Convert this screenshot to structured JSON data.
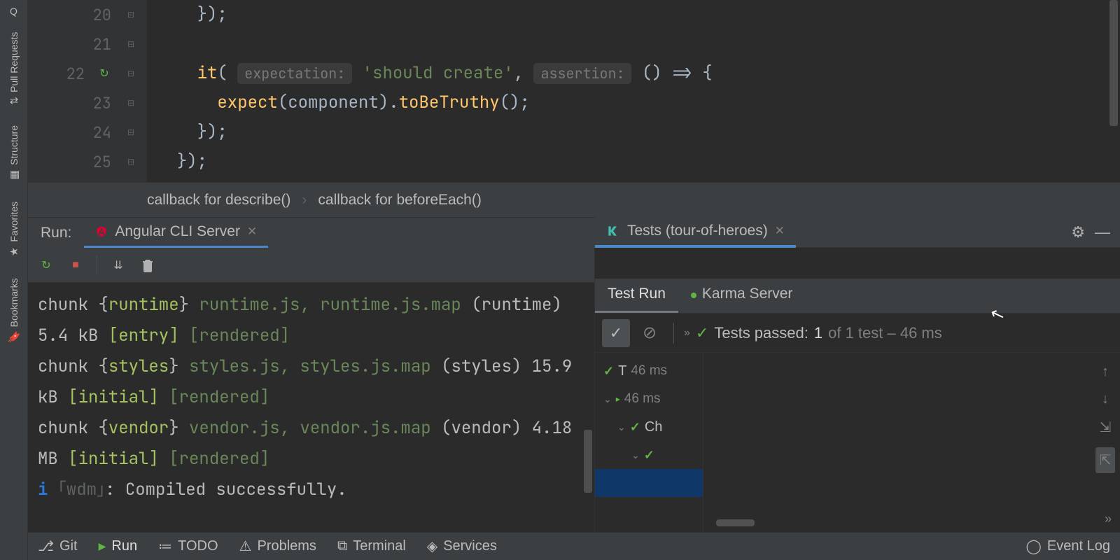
{
  "left_rail": {
    "items": [
      "Q",
      "Pull Requests",
      "Structure",
      "Favorites",
      "Bookmarks"
    ]
  },
  "editor": {
    "lines": [
      {
        "num": "20",
        "indent": "    ",
        "tokens": [
          {
            "t": "});",
            "cls": "kw-gray"
          }
        ]
      },
      {
        "num": "21",
        "indent": "",
        "tokens": []
      },
      {
        "num": "22",
        "run": true,
        "indent": "    ",
        "tokens": [
          {
            "t": "it",
            "cls": "kw-yellow"
          },
          {
            "t": "( ",
            "cls": "kw-gray"
          },
          {
            "hint": "expectation:"
          },
          {
            "t": " ",
            "cls": "kw-gray"
          },
          {
            "t": "'should create'",
            "cls": "kw-green"
          },
          {
            "t": ", ",
            "cls": "kw-gray"
          },
          {
            "hint": "assertion:"
          },
          {
            "t": " () => {",
            "cls": "kw-gray"
          }
        ]
      },
      {
        "num": "23",
        "indent": "      ",
        "tokens": [
          {
            "t": "expect",
            "cls": "kw-yellow"
          },
          {
            "t": "(",
            "cls": "kw-gray"
          },
          {
            "t": "component",
            "cls": "kw-gray"
          },
          {
            "t": ").",
            "cls": "kw-gray"
          },
          {
            "t": "toBeTruthy",
            "cls": "kw-yellow"
          },
          {
            "t": "();",
            "cls": "kw-gray"
          }
        ]
      },
      {
        "num": "24",
        "indent": "    ",
        "tokens": [
          {
            "t": "});",
            "cls": "kw-gray"
          }
        ]
      },
      {
        "num": "25",
        "indent": "  ",
        "tokens": [
          {
            "t": "});",
            "cls": "kw-gray"
          }
        ]
      }
    ]
  },
  "breadcrumb": {
    "items": [
      "callback for describe()",
      "callback for beforeEach()"
    ]
  },
  "run_panel": {
    "label": "Run:",
    "tabs": [
      {
        "name": "Angular CLI Server",
        "active": true
      },
      {
        "name": "Tests (tour-of-heroes)",
        "active": true
      }
    ]
  },
  "console": {
    "lines": [
      [
        {
          "t": "chunk {",
          "cls": "c-white"
        },
        {
          "t": "runtime",
          "cls": "c-yellow"
        },
        {
          "t": "} ",
          "cls": "c-white"
        },
        {
          "t": "runtime.js, runtime.js.map",
          "cls": "c-green"
        },
        {
          "t": " (runtime) 5.4 kB ",
          "cls": "c-white"
        },
        {
          "t": "[entry]",
          "cls": "c-yellow"
        },
        {
          "t": " ",
          "cls": "c-white"
        },
        {
          "t": "[rendered]",
          "cls": "c-green"
        }
      ],
      [
        {
          "t": "chunk {",
          "cls": "c-white"
        },
        {
          "t": "styles",
          "cls": "c-yellow"
        },
        {
          "t": "} ",
          "cls": "c-white"
        },
        {
          "t": "styles.js, styles.js.map",
          "cls": "c-green"
        },
        {
          "t": " (styles) 15.9 kB ",
          "cls": "c-white"
        },
        {
          "t": "[initial]",
          "cls": "c-yellow"
        },
        {
          "t": " ",
          "cls": "c-white"
        },
        {
          "t": "[rendered]",
          "cls": "c-green"
        }
      ],
      [
        {
          "t": "chunk {",
          "cls": "c-white"
        },
        {
          "t": "vendor",
          "cls": "c-yellow"
        },
        {
          "t": "} ",
          "cls": "c-white"
        },
        {
          "t": "vendor.js, vendor.js.map",
          "cls": "c-green"
        },
        {
          "t": " (vendor) 4.18 MB ",
          "cls": "c-white"
        },
        {
          "t": "[initial]",
          "cls": "c-yellow"
        },
        {
          "t": " ",
          "cls": "c-white"
        },
        {
          "t": "[rendered]",
          "cls": "c-green"
        }
      ],
      [
        {
          "t": "i",
          "cls": "c-info"
        },
        {
          "t": " ｢wdm｣",
          "cls": "c-dim"
        },
        {
          "t": ": Compiled successfully.",
          "cls": "c-white"
        }
      ]
    ]
  },
  "tests": {
    "subtabs": [
      {
        "label": "Test Run",
        "active": true
      },
      {
        "label": "Karma Server",
        "active": false,
        "dot": true
      }
    ],
    "status": {
      "overflow": "»",
      "prefix": "Tests passed: ",
      "count": "1",
      "of": " of 1 test – 46 ms"
    },
    "tree": [
      {
        "indent": 0,
        "check": true,
        "label": "T",
        "time": "46 ms"
      },
      {
        "indent": 0,
        "chevron": true,
        "run": true,
        "time": "46 ms"
      },
      {
        "indent": 1,
        "chevron": true,
        "check": true,
        "label": "Ch"
      },
      {
        "indent": 2,
        "chevron": true,
        "check": true,
        "label": ""
      }
    ]
  },
  "bottom_bar": {
    "left": [
      {
        "label": "Git",
        "icon": "branch"
      },
      {
        "label": "Run",
        "icon": "play",
        "active": true
      },
      {
        "label": "TODO",
        "icon": "list"
      },
      {
        "label": "Problems",
        "icon": "warn"
      },
      {
        "label": "Terminal",
        "icon": "terminal"
      },
      {
        "label": "Services",
        "icon": "services"
      }
    ],
    "right": {
      "label": "Event Log"
    }
  }
}
